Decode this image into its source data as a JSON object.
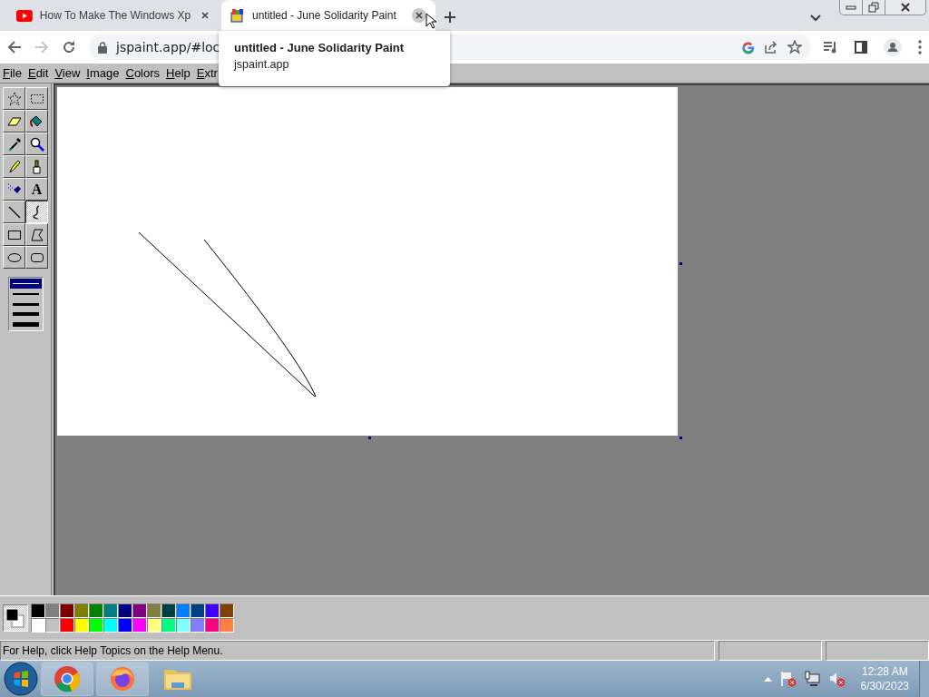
{
  "browser_tabs": [
    {
      "title": "How To Make The Windows Xp",
      "selected": false
    },
    {
      "title": "untitled - June Solidarity Paint",
      "selected": true
    }
  ],
  "address_bar": {
    "url": "jspaint.app/#loc"
  },
  "tooltip": {
    "title": "untitled - June Solidarity Paint",
    "url": "jspaint.app"
  },
  "menu": [
    "File",
    "Edit",
    "View",
    "Image",
    "Colors",
    "Help",
    "Extr"
  ],
  "tools": [
    {
      "selected": false
    },
    {
      "selected": false
    },
    {
      "selected": false
    },
    {
      "selected": false
    },
    {
      "selected": false
    },
    {
      "selected": false
    },
    {
      "selected": false
    },
    {
      "selected": false
    },
    {
      "selected": false
    },
    {
      "selected": false,
      "label": "A"
    },
    {
      "selected": false
    },
    {
      "selected": true
    },
    {
      "selected": false
    },
    {
      "selected": false
    },
    {
      "selected": false
    },
    {
      "selected": false
    }
  ],
  "line_widths": [
    {
      "selected": true
    },
    {
      "selected": false
    },
    {
      "selected": false
    },
    {
      "selected": false
    },
    {
      "selected": false
    }
  ],
  "palette": [
    {
      "color": "#000000"
    },
    {
      "color": "#808080"
    },
    {
      "color": "#800000"
    },
    {
      "color": "#808000"
    },
    {
      "color": "#008000"
    },
    {
      "color": "#008080"
    },
    {
      "color": "#000080"
    },
    {
      "color": "#800080"
    },
    {
      "color": "#808040"
    },
    {
      "color": "#004040"
    },
    {
      "color": "#0080ff"
    },
    {
      "color": "#004080"
    },
    {
      "color": "#4000ff"
    },
    {
      "color": "#804000"
    },
    {
      "color": "#ffffff"
    },
    {
      "color": "#c0c0c0"
    },
    {
      "color": "#ff0000"
    },
    {
      "color": "#ffff00"
    },
    {
      "color": "#00ff00"
    },
    {
      "color": "#00ffff"
    },
    {
      "color": "#0000ff"
    },
    {
      "color": "#ff00ff"
    },
    {
      "color": "#ffff80"
    },
    {
      "color": "#00ff80"
    },
    {
      "color": "#80ffff"
    },
    {
      "color": "#8080ff"
    },
    {
      "color": "#ff0080"
    },
    {
      "color": "#ff8040"
    }
  ],
  "status_bar": {
    "text": "For Help, click Help Topics on the Help Menu."
  },
  "clock": {
    "time": "12:28 AM",
    "date": "6/30/2023"
  }
}
